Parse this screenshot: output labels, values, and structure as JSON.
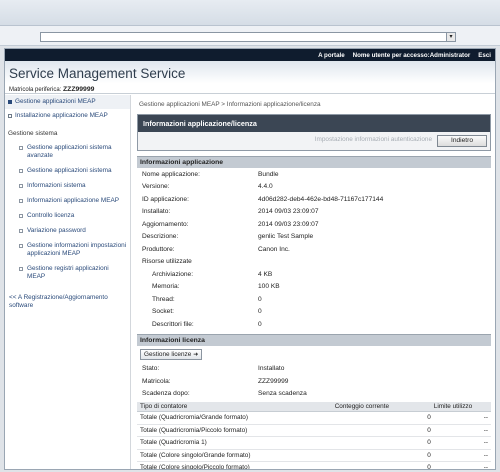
{
  "browser": {
    "go_button": "▾"
  },
  "topbar": {
    "portal": "A portale",
    "user": "Nome utente per accesso:Administrator",
    "logout": "Esci"
  },
  "header": {
    "title": "Service Management Service",
    "serial_label": "Matricola periferica:",
    "serial_value": "ZZZ99999"
  },
  "sidebar": {
    "top_items": [
      {
        "label": "Gestione applicazioni MEAP"
      },
      {
        "label": "Installazione applicazione MEAP"
      }
    ],
    "section_label": "Gestione sistema",
    "sub_items": [
      {
        "label": "Gestione applicazioni sistema avanzate"
      },
      {
        "label": "Gestione applicazioni sistema"
      },
      {
        "label": "Informazioni sistema"
      },
      {
        "label": "Informazioni applicazione MEAP"
      },
      {
        "label": "Controllo licenza"
      },
      {
        "label": "Variazione password"
      },
      {
        "label": "Gestione informazioni impostazioni applicazioni MEAP"
      },
      {
        "label": "Gestione registri applicazioni MEAP"
      }
    ],
    "bottom_link": "<< A Registrazione/Aggiornamento software"
  },
  "main": {
    "breadcrumb": "Gestione applicazioni MEAP > Informazioni applicazione/licenza",
    "panel_title": "Informazioni applicazione/licenza",
    "auth_button": "Impostazione informazioni autenticazione",
    "back_button": "Indietro",
    "app_section": "Informazioni applicazione",
    "app_rows": [
      {
        "k": "Nome applicazione:",
        "v": "Bundle"
      },
      {
        "k": "Versione:",
        "v": "4.4.0"
      },
      {
        "k": "ID applicazione:",
        "v": "4d06d282-deb4-462e-bd48-71167c177144"
      },
      {
        "k": "Installato:",
        "v": "2014 09/03 23:09:07"
      },
      {
        "k": "Aggiornamento:",
        "v": "2014 09/03 23:09:07"
      },
      {
        "k": "Descrizione:",
        "v": "genlic Test Sample"
      },
      {
        "k": "Produttore:",
        "v": "Canon Inc."
      },
      {
        "k": "Risorse utilizzate",
        "v": ""
      }
    ],
    "resource_rows": [
      {
        "k": "Archiviazione:",
        "v": "4 KB"
      },
      {
        "k": "Memoria:",
        "v": "100 KB"
      },
      {
        "k": "Thread:",
        "v": "0"
      },
      {
        "k": "Socket:",
        "v": "0"
      },
      {
        "k": "Descrittori file:",
        "v": "0"
      }
    ],
    "license_section": "Informazioni licenza",
    "license_button": "Gestione licenze",
    "license_rows": [
      {
        "k": "Stato:",
        "v": "Installato"
      },
      {
        "k": "Matricola:",
        "v": "ZZZ99999"
      },
      {
        "k": "Scadenza dopo:",
        "v": "Senza scadenza"
      }
    ],
    "counter_headers": [
      "Tipo di contatore",
      "Conteggio corrente",
      "Limite utilizzo"
    ],
    "counters": [
      {
        "type": "Totale (Quadricromia/Grande formato)",
        "count": "0",
        "limit": "--"
      },
      {
        "type": "Totale (Quadricromia/Piccolo formato)",
        "count": "0",
        "limit": "--"
      },
      {
        "type": "Totale (Quadricromia 1)",
        "count": "0",
        "limit": "--"
      },
      {
        "type": "Totale (Colore singolo/Grande formato)",
        "count": "0",
        "limit": "--"
      },
      {
        "type": "Totale (Colore singolo/Piccolo formato)",
        "count": "0",
        "limit": "--"
      }
    ]
  }
}
